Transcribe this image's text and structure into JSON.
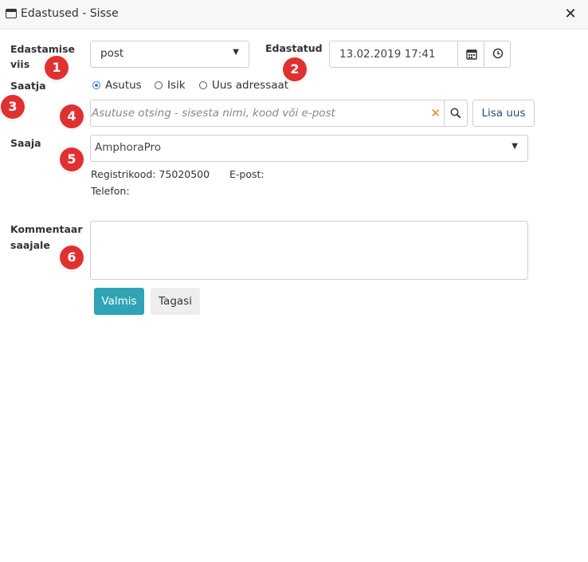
{
  "window": {
    "title": "Edastused - Sisse",
    "icon": "window-icon",
    "close_icon": "close-icon",
    "close_glyph": "✕"
  },
  "form": {
    "method_label_1": "Edastamise",
    "method_label_2": "viis",
    "method_value": "post",
    "sent_label": "Edastatud",
    "sent_value": "13.02.2019 17:41",
    "calendar_icon": "calendar-icon",
    "clock_icon": "clock-icon",
    "sender_label": "Saatja",
    "sender_options": [
      {
        "label": "Asutus",
        "selected": true
      },
      {
        "label": "Isik",
        "selected": false
      },
      {
        "label": "Uus adressaat",
        "selected": false
      }
    ],
    "search_placeholder": "Asutuse otsing - sisesta nimi, kood või e-post",
    "clear_glyph": "✕",
    "add_new_label": "Lisa uus",
    "recipient_label": "Saaja",
    "recipient_value": "AmphoraPro",
    "reg_code": "Registrikood: 75020500",
    "email": "E-post:",
    "phone": "Telefon:",
    "comment_label_1": "Kommentaar",
    "comment_label_2": "saajale",
    "comment_value": "",
    "done_label": "Valmis",
    "back_label": "Tagasi"
  },
  "badges": [
    "1",
    "2",
    "3",
    "4",
    "5",
    "6"
  ],
  "colors": {
    "accent": "#2fa4b5",
    "badge": "#e03131",
    "clear": "#e08a1e"
  }
}
